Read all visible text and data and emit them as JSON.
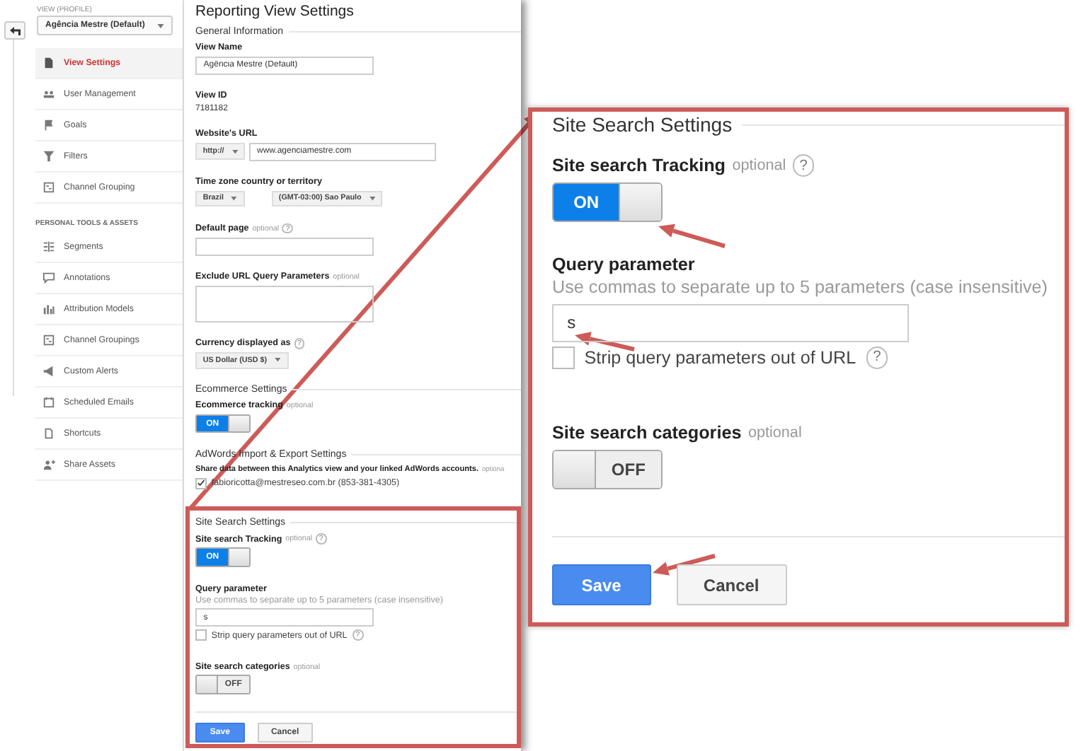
{
  "sidebar": {
    "view_label": "VIEW (PROFILE)",
    "view_selector": "Agência Mestre (Default)",
    "items": [
      {
        "kind": "item",
        "label": "View Settings",
        "selected": true
      },
      {
        "kind": "item",
        "label": "User Management",
        "selected": false
      },
      {
        "kind": "item",
        "label": "Goals",
        "selected": false
      },
      {
        "kind": "item",
        "label": "Filters",
        "selected": false
      },
      {
        "kind": "item",
        "label": "Channel Grouping",
        "selected": false
      },
      {
        "kind": "header",
        "label": "PERSONAL TOOLS & ASSETS"
      },
      {
        "kind": "item",
        "label": "Segments",
        "selected": false
      },
      {
        "kind": "item",
        "label": "Annotations",
        "selected": false
      },
      {
        "kind": "item",
        "label": "Attribution Models",
        "selected": false
      },
      {
        "kind": "item",
        "label": "Channel Groupings",
        "selected": false
      },
      {
        "kind": "item",
        "label": "Custom Alerts",
        "selected": false
      },
      {
        "kind": "item",
        "label": "Scheduled Emails",
        "selected": false
      },
      {
        "kind": "item",
        "label": "Shortcuts",
        "selected": false
      },
      {
        "kind": "item",
        "label": "Share Assets",
        "selected": false
      }
    ]
  },
  "main": {
    "title": "Reporting View Settings",
    "sections": [
      {
        "heading": "General Information",
        "fields": [
          {
            "kind": "text",
            "label": "View Name",
            "value": "Agência Mestre (Default)"
          },
          {
            "kind": "static",
            "label": "View ID",
            "value": "7181182"
          },
          {
            "kind": "url",
            "label": "Website's URL",
            "protocol": "http://",
            "value": "www.agenciamestre.com"
          },
          {
            "kind": "selects",
            "label": "Time zone country or territory",
            "options": [
              "Brazil",
              "(GMT-03:00) Sao Paulo"
            ]
          },
          {
            "kind": "text",
            "label": "Default page",
            "optional": "optional",
            "help": "?"
          },
          {
            "kind": "textarea",
            "label": "Exclude URL Query Parameters",
            "optional": "optional"
          },
          {
            "kind": "select",
            "label": "Currency displayed as",
            "help": "?",
            "value": "US Dollar (USD $)"
          }
        ]
      },
      {
        "heading": "Ecommerce Settings",
        "fields": [
          {
            "kind": "toggle",
            "label": "Ecommerce tracking",
            "optional": "optional",
            "on": true,
            "text": "ON"
          }
        ]
      },
      {
        "heading": "AdWords Import & Export Settings",
        "fields": [
          {
            "kind": "note",
            "label": "Share data between this Analytics view and your linked AdWords accounts.",
            "optional": "optiona"
          },
          {
            "kind": "checkbox",
            "label": "fabioricotta@mestreseo.com.br (853-381-4305)",
            "checked": true
          }
        ]
      },
      {
        "heading": "Site Search Settings",
        "fields": [
          {
            "kind": "toggle",
            "label": "Site search Tracking",
            "optional": "optional",
            "help": "?",
            "on": true,
            "text": "ON"
          },
          {
            "kind": "text",
            "label": "Query parameter",
            "hint": "Use commas to separate up to 5 parameters (case insensitive)",
            "value": "s"
          },
          {
            "kind": "checkbox",
            "label": "Strip query parameters out of URL",
            "help": "?",
            "checked": false
          },
          {
            "kind": "toggle",
            "label": "Site search categories",
            "optional": "optional",
            "on": false,
            "text": "OFF"
          }
        ]
      }
    ],
    "buttons": [
      {
        "kind": "primary",
        "label": "Save"
      },
      {
        "kind": "default",
        "label": "Cancel"
      }
    ]
  },
  "callout": {
    "sections": [
      {
        "heading": "Site Search Settings",
        "fields": [
          {
            "kind": "toggle",
            "label": "Site search Tracking",
            "optional": "optional",
            "help": "?",
            "on": true,
            "text": "ON"
          },
          {
            "kind": "text",
            "label": "Query parameter",
            "hint": "Use commas to separate up to 5 parameters (case insensitive)",
            "value": "s"
          },
          {
            "kind": "checkbox",
            "label": "Strip query parameters out of URL",
            "help": "?",
            "checked": false
          },
          {
            "kind": "toggle",
            "label": "Site search categories",
            "optional": "optional",
            "on": false,
            "text": "OFF"
          }
        ]
      }
    ],
    "buttons": [
      {
        "kind": "primary",
        "label": "Save"
      },
      {
        "kind": "default",
        "label": "Cancel"
      }
    ]
  }
}
